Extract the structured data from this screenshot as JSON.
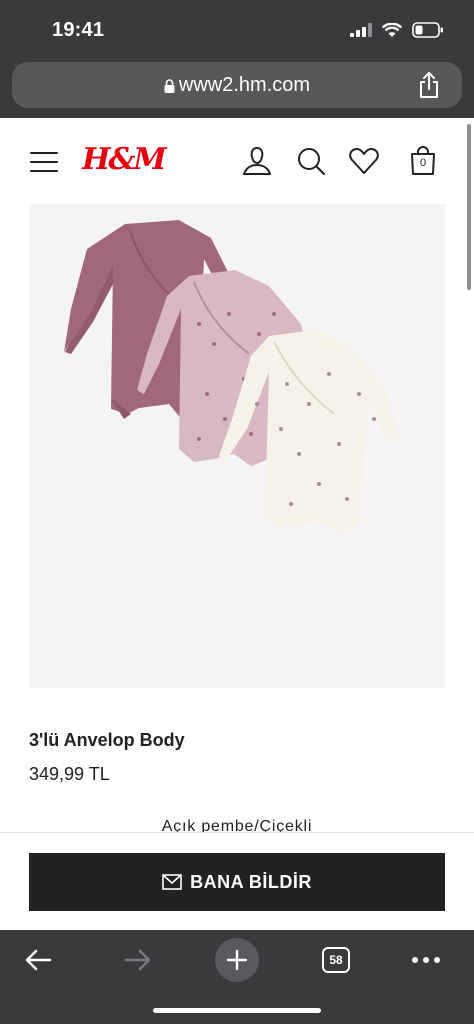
{
  "status": {
    "time": "19:41"
  },
  "browser": {
    "url": "www2.hm.com",
    "tab_count": "58"
  },
  "header": {
    "logo": "H&M",
    "cart_count": "0"
  },
  "product": {
    "title": "3'lü Anvelop Body",
    "price": "349,99 TL",
    "color": "Açık pembe/Çiçekli",
    "notify_label": "BANA BİLDİR"
  },
  "colors": {
    "brand": "#e50010",
    "button": "#222222",
    "chrome": "#3a3a3c"
  }
}
